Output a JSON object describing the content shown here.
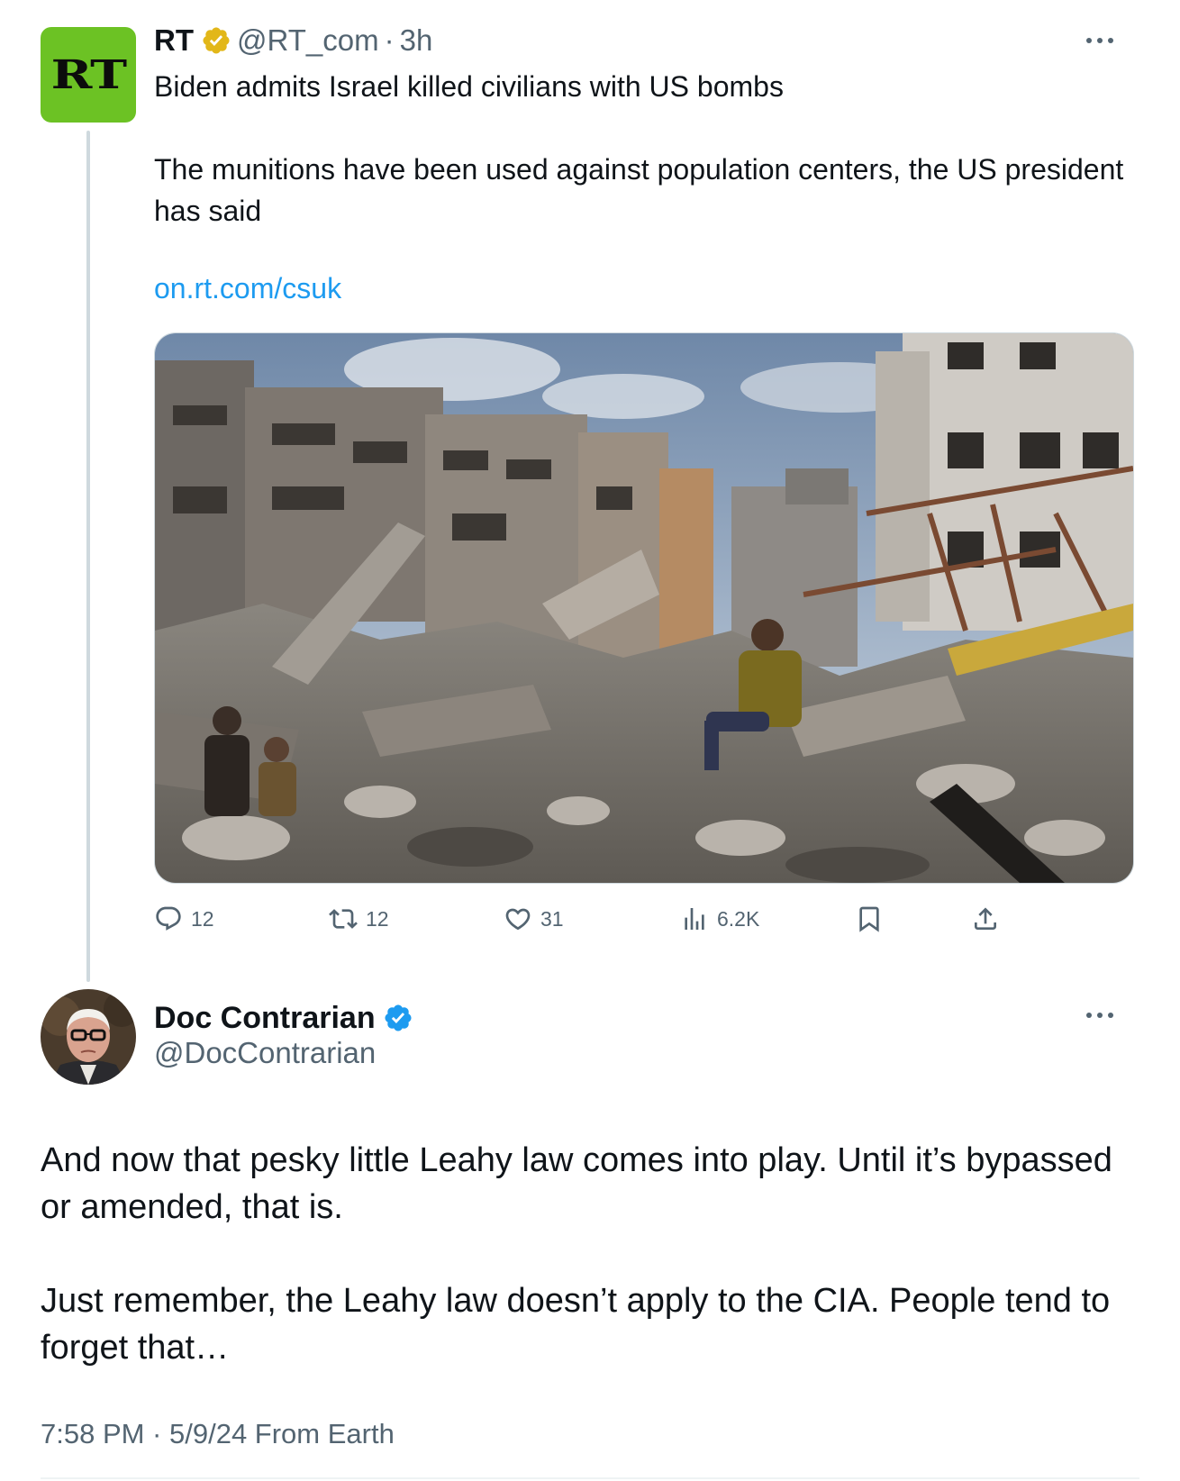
{
  "parent_tweet": {
    "author_name": "RT",
    "avatar_text": "RT",
    "handle": "@RT_com",
    "separator": "·",
    "time": "3h",
    "headline": "Biden admits Israel killed civilians with US bombs",
    "body": "The munitions have been used against population centers, the US president has said",
    "link": "on.rt.com/csuk",
    "media_icon": "photo-rubble-destroyed-street",
    "actions": {
      "replies": "12",
      "reposts": "12",
      "likes": "31",
      "views": "6.2K"
    }
  },
  "reply_tweet": {
    "author_name": "Doc Contrarian",
    "handle": "@DocContrarian",
    "paragraph_1": "And now that pesky little Leahy law comes into play. Until it’s bypassed or amended, that is.",
    "paragraph_2": "Just remember, the Leahy law doesn’t apply to the CIA. People tend to forget that…",
    "timestamp": "7:58 PM · 5/9/24 From Earth"
  },
  "colors": {
    "text_primary": "#0f1419",
    "text_secondary": "#536471",
    "link": "#1d9bf0",
    "rt_green": "#6cc224",
    "gold_badge": "#e2b719",
    "blue_badge": "#1d9bf0",
    "thread_line": "#cfd9de"
  },
  "icons": [
    "gold-verified-icon",
    "blue-verified-icon",
    "more-icon",
    "reply-icon",
    "repost-icon",
    "like-icon",
    "views-icon",
    "bookmark-icon",
    "share-icon"
  ]
}
